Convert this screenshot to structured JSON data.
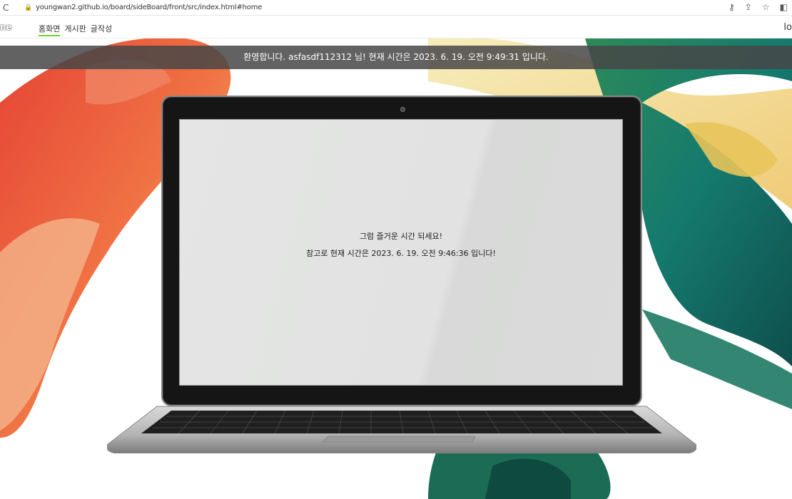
{
  "browser": {
    "url": "youngwan2.github.io/board/sideBoard/front/src/index.html#home",
    "reload_icon": "reload-icon",
    "lock_icon": "lock-icon"
  },
  "nav": {
    "logo": "me",
    "links": [
      "홈화면",
      "게시판",
      "글작성"
    ],
    "login": "lo"
  },
  "welcome": {
    "text": "환영합니다. asfasdf112312 님! 현재 시간은 2023. 6. 19. 오전 9:49:31 입니다."
  },
  "screen": {
    "line1": "그럼 즐거운 시간 되세요!",
    "line2": "참고로 현재 시간은 2023. 6. 19. 오전 9:46:36 입니다!"
  },
  "colors": {
    "nav_underline": "#6bd42a",
    "welcome_bg": "#464646"
  }
}
